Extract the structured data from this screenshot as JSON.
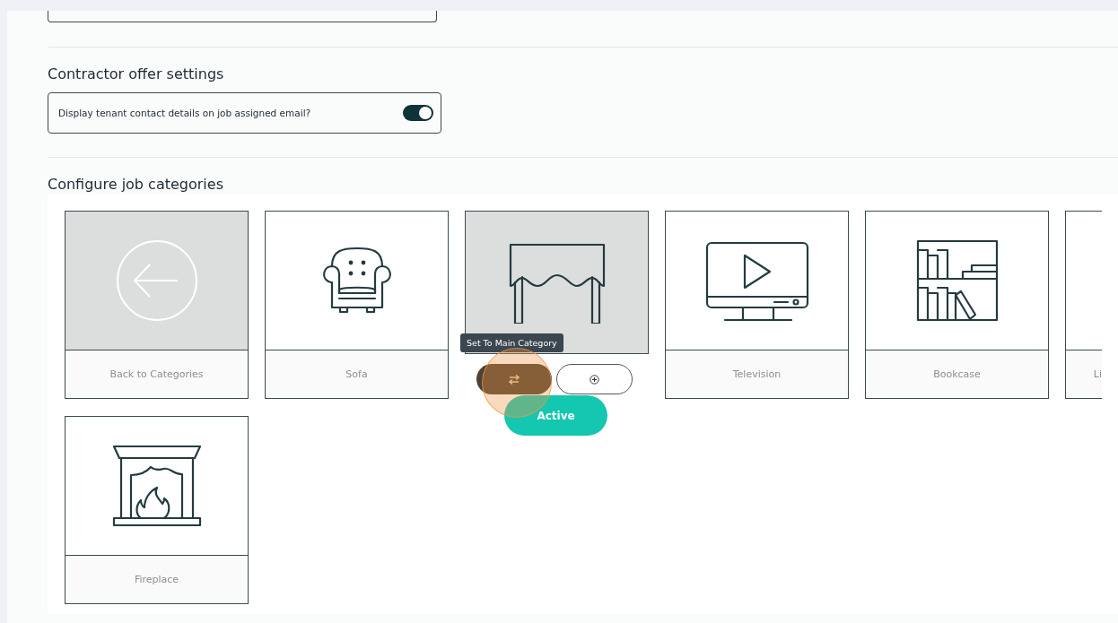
{
  "contractor_settings": {
    "heading": "Contractor offer settings",
    "options": [
      {
        "label": "Display tenant contact details on job assigned email?",
        "on": true
      }
    ]
  },
  "job_categories": {
    "heading": "Configure job categories",
    "tiles": [
      {
        "kind": "back",
        "label": "Back to Categories"
      },
      {
        "kind": "category",
        "label": "Sofa"
      },
      {
        "kind": "active",
        "tooltip": "Set To Main Category",
        "status": "Active"
      },
      {
        "kind": "category",
        "label": "Television"
      },
      {
        "kind": "category",
        "label": "Bookcase"
      },
      {
        "kind": "partial",
        "label": "Li"
      },
      {
        "kind": "category",
        "label": "Fireplace"
      }
    ]
  }
}
